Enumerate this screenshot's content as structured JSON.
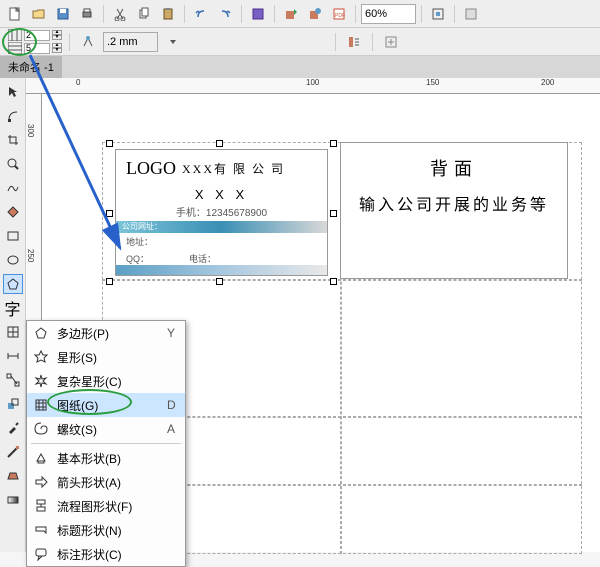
{
  "toolbar": {
    "zoom": "60%"
  },
  "toolbar2": {
    "rows": "2",
    "cols": "5",
    "outline": ".2 mm"
  },
  "doc_tab": "未命名 -1",
  "ruler_top": [
    "0",
    "100",
    "150",
    "200"
  ],
  "ruler_left": [
    "300",
    "250"
  ],
  "card_front": {
    "logo": "LOGO",
    "company": "XXX有 限 公 司",
    "name": "X X X",
    "phone_label": "手机：",
    "phone": "12345678900",
    "url_label": "公司网址：",
    "addr_label": "地址：",
    "qq_label": "QQ：",
    "tel_label": "电话："
  },
  "card_back": {
    "title": "背面",
    "body": "输入公司开展的业务等"
  },
  "menu": {
    "items": [
      {
        "label": "多边形(P)",
        "key": "Y",
        "icon": "polygon"
      },
      {
        "label": "星形(S)",
        "key": "",
        "icon": "star"
      },
      {
        "label": "复杂星形(C)",
        "key": "",
        "icon": "complex-star"
      },
      {
        "label": "图纸(G)",
        "key": "D",
        "icon": "graph-paper"
      },
      {
        "label": "螺纹(S)",
        "key": "A",
        "icon": "spiral"
      }
    ],
    "items2": [
      {
        "label": "基本形状(B)",
        "icon": "basic-shape"
      },
      {
        "label": "箭头形状(A)",
        "icon": "arrow-shape"
      },
      {
        "label": "流程图形状(F)",
        "icon": "flowchart"
      },
      {
        "label": "标题形状(N)",
        "icon": "banner"
      },
      {
        "label": "标注形状(C)",
        "icon": "callout"
      }
    ]
  }
}
